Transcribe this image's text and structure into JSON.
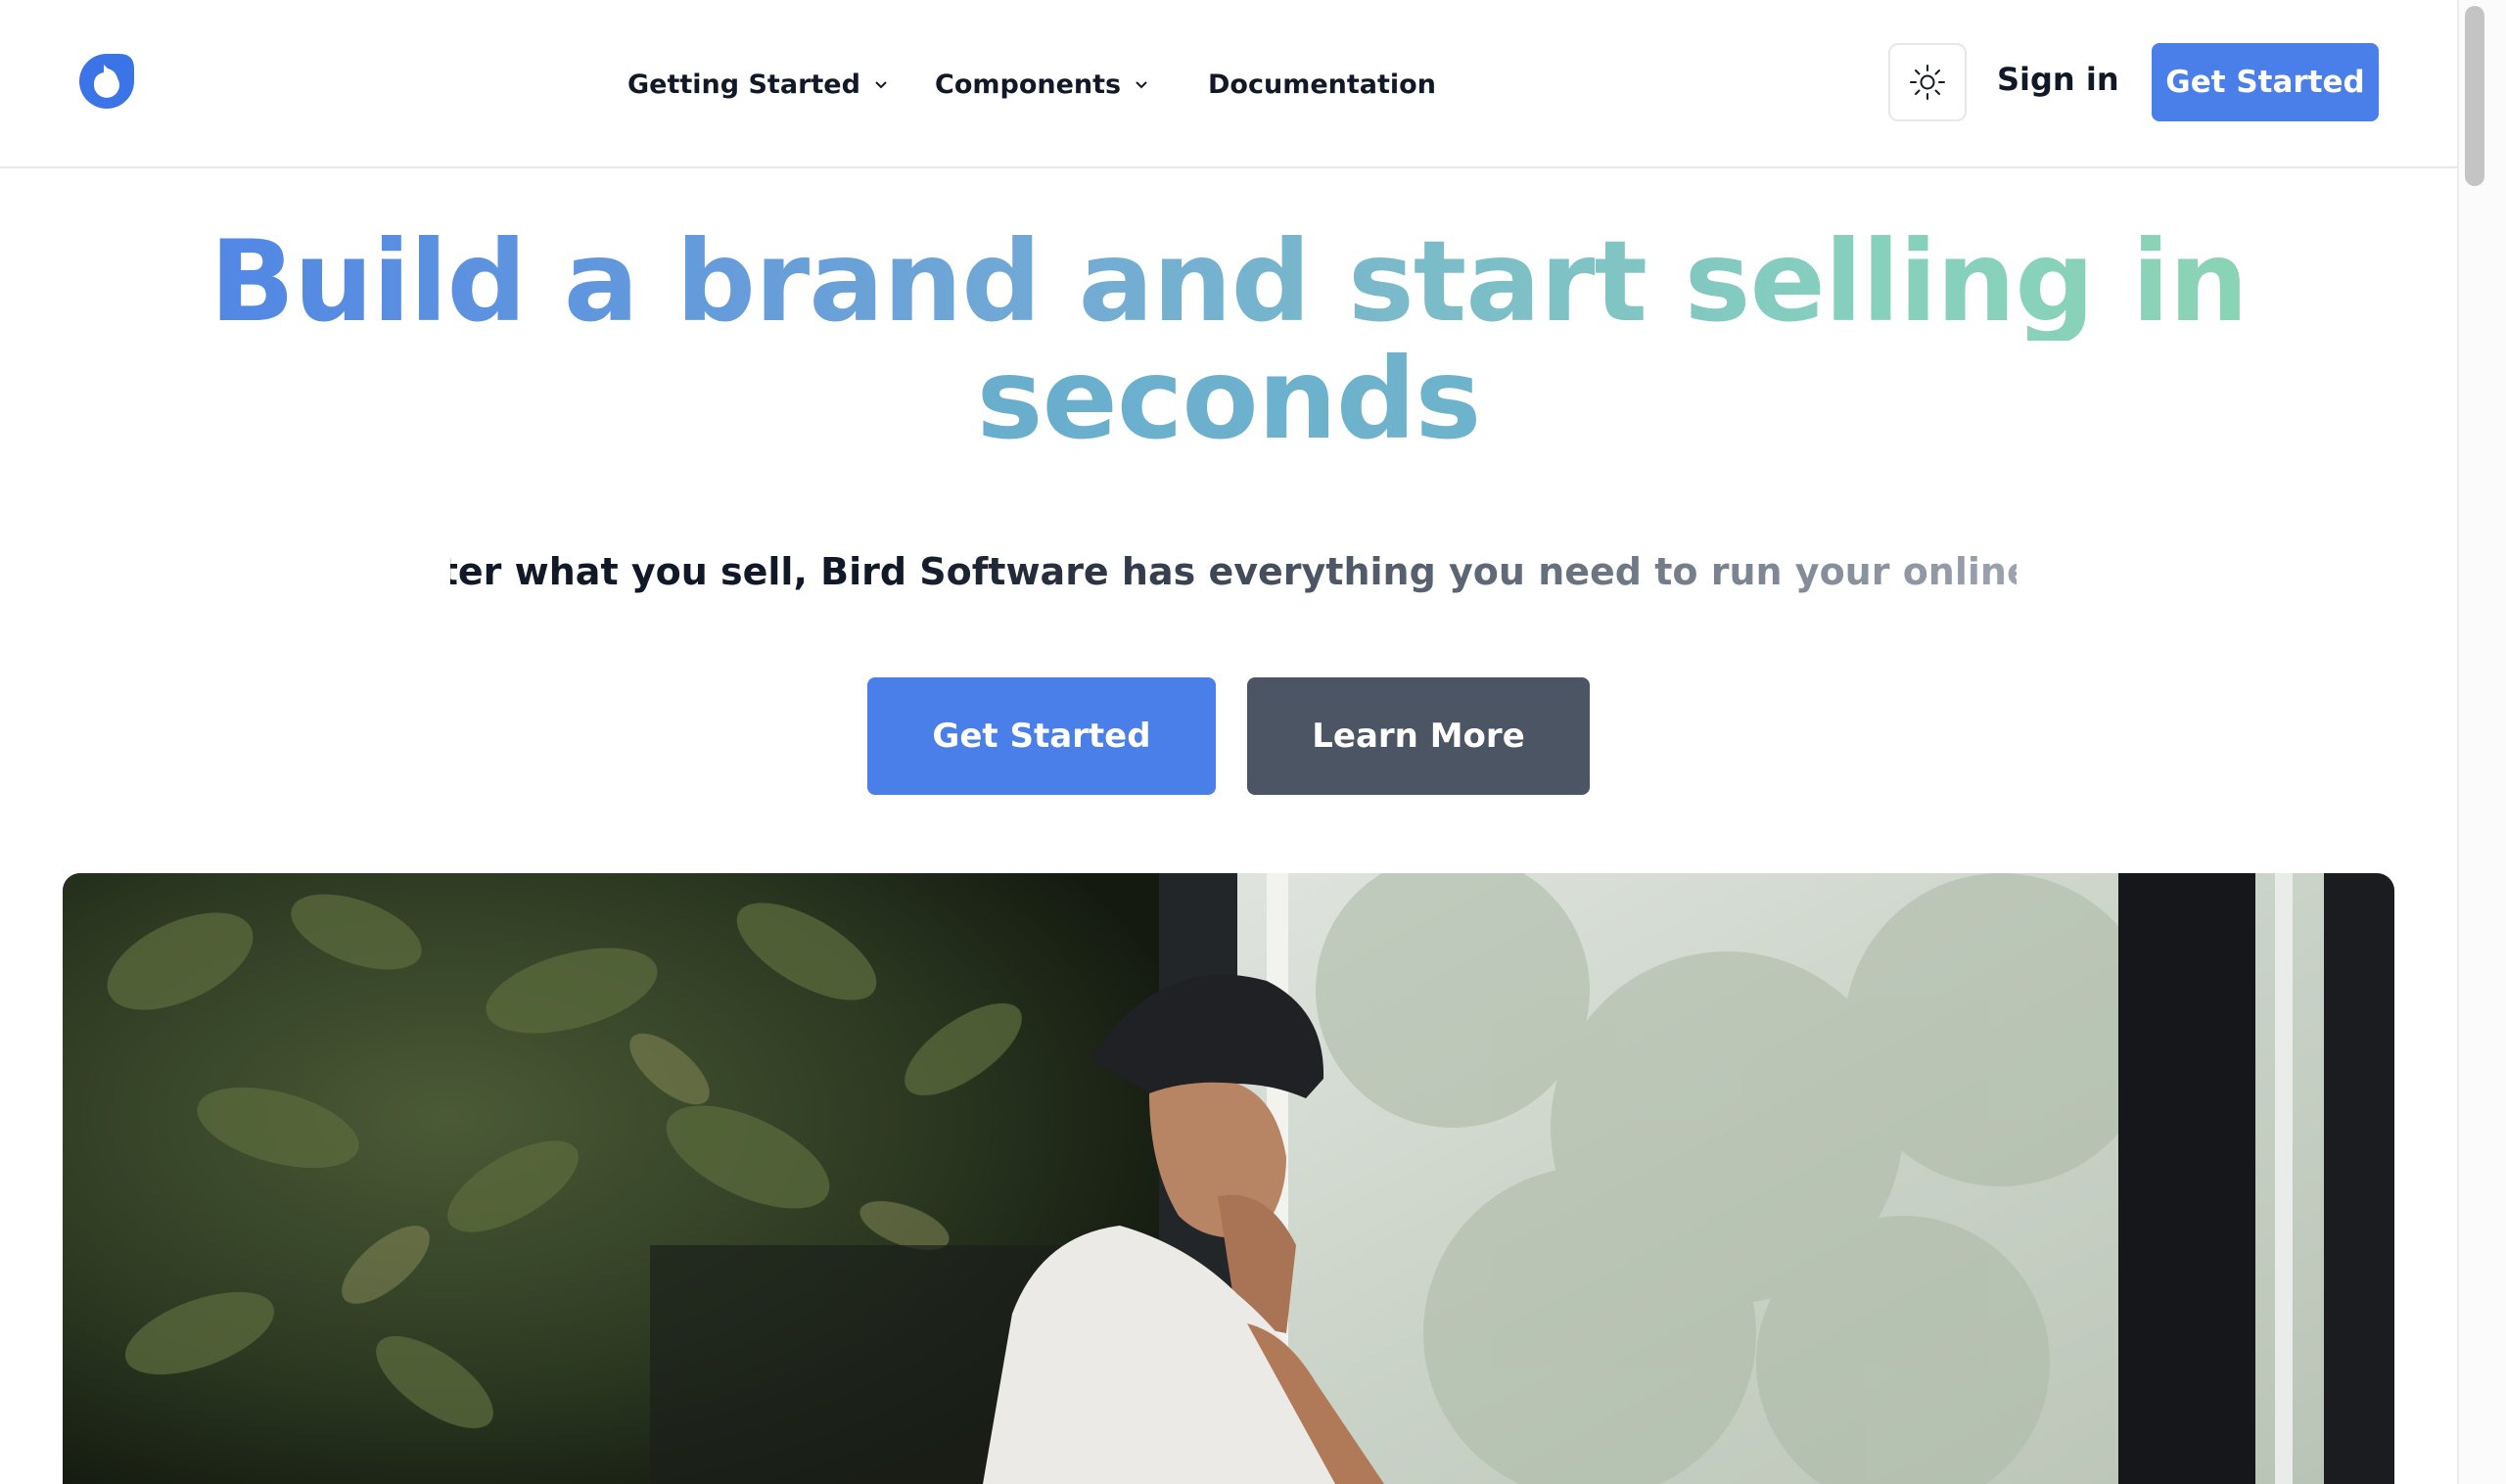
{
  "header": {
    "nav": [
      {
        "label": "Getting Started",
        "has_dropdown": true
      },
      {
        "label": "Components",
        "has_dropdown": true
      },
      {
        "label": "Documentation",
        "has_dropdown": false
      }
    ],
    "theme_toggle_icon": "sun-icon",
    "signin_label": "Sign in",
    "cta_label": "Get Started"
  },
  "hero": {
    "title_line1": "Build a brand and start selling in",
    "title_line2": "seconds",
    "subtitle": "No matter what you sell, Bird Software has everything you need to run your online store.",
    "primary_label": "Get Started",
    "secondary_label": "Learn More"
  },
  "colors": {
    "accent": "#4a7ee8",
    "secondary_button": "#4b5563",
    "gradient_start": "#4a7ee8",
    "gradient_end": "#8dd6b2"
  }
}
